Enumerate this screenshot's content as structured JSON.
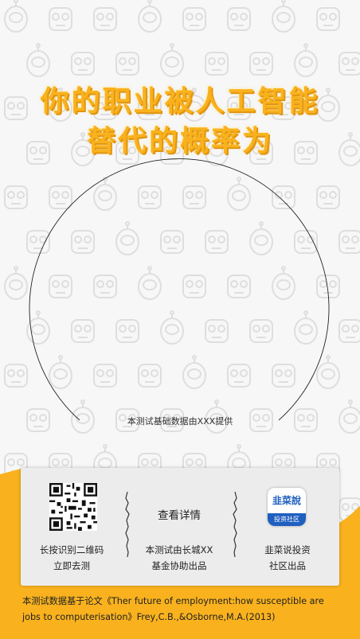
{
  "headline": {
    "line1": "你的职业被人工智能",
    "line2": "替代的概率为"
  },
  "result": {
    "provider_note": "本测试基础数据由XXX提供"
  },
  "card": {
    "qr": {
      "line1": "长按识别二维码",
      "line2": "立即去测"
    },
    "detail": {
      "button_label": "查看详情",
      "line1": "本测试由长城XX",
      "line2": "基金协助出品"
    },
    "community": {
      "logo_top": "韭菜說",
      "logo_bottom": "投资社区",
      "line1": "韭菜说投资",
      "line2": "社区出品"
    }
  },
  "footnote": "本测试数据基于论文《Ther future of employment:how susceptible are jobs to computerisation》Frey,C.B.,&Osborne,M.A.(2013)",
  "colors": {
    "accent": "#f9b21e",
    "logo_blue": "#1f5fbf"
  }
}
